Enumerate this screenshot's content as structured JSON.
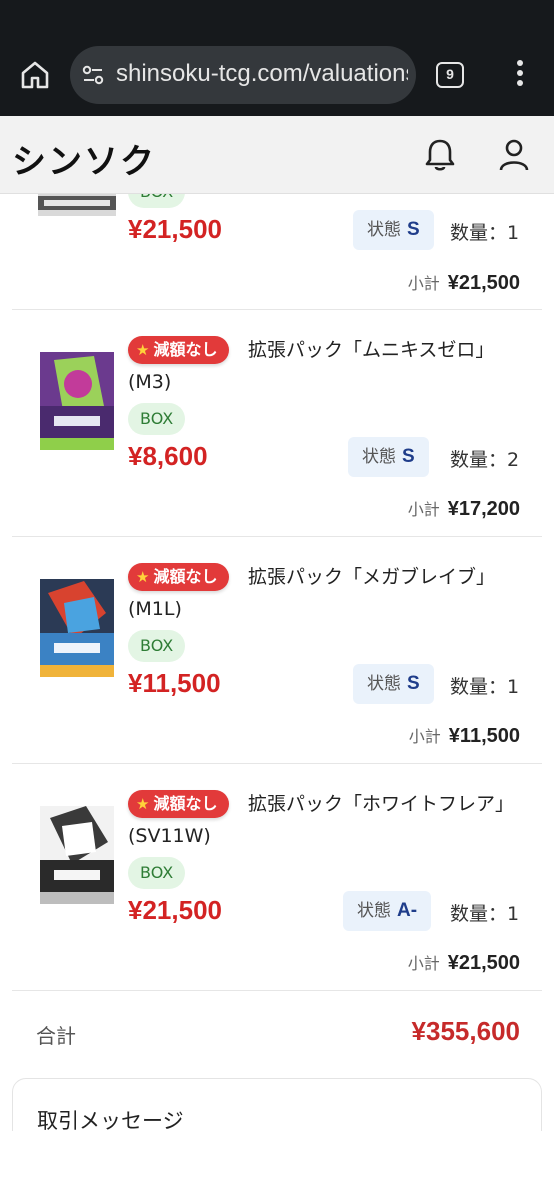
{
  "browser": {
    "url": "shinsoku-tcg.com/valuations",
    "tab_count": "9"
  },
  "header": {
    "logo": "シンソク"
  },
  "items": [
    {
      "box": "BOX",
      "price": "¥21,500",
      "condition_label": "状態",
      "condition_value": "S",
      "quantity": "数量：1",
      "subtotal_label": "小計",
      "subtotal": "¥21,500"
    },
    {
      "badge": "減額なし",
      "title": "拡張パック「ムニキスゼロ」(M3)",
      "box": "BOX",
      "price": "¥8,600",
      "condition_label": "状態",
      "condition_value": "S",
      "quantity": "数量：2",
      "subtotal_label": "小計",
      "subtotal": "¥17,200"
    },
    {
      "badge": "減額なし",
      "title": "拡張パック「メガブレイブ」(M1L)",
      "box": "BOX",
      "price": "¥11,500",
      "condition_label": "状態",
      "condition_value": "S",
      "quantity": "数量：1",
      "subtotal_label": "小計",
      "subtotal": "¥11,500"
    },
    {
      "badge": "減額なし",
      "title": "拡張パック「ホワイトフレア」(SV11W)",
      "box": "BOX",
      "price": "¥21,500",
      "condition_label": "状態",
      "condition_value": "A-",
      "quantity": "数量：1",
      "subtotal_label": "小計",
      "subtotal": "¥21,500"
    }
  ],
  "total": {
    "label": "合計",
    "value": "¥355,600"
  },
  "message_section": {
    "title": "取引メッセージ"
  },
  "colors": {
    "price_red": "#d32323",
    "badge_red": "#e23a3a",
    "box_green": "#2f7d36",
    "condition_blue": "#1f3d8a"
  }
}
